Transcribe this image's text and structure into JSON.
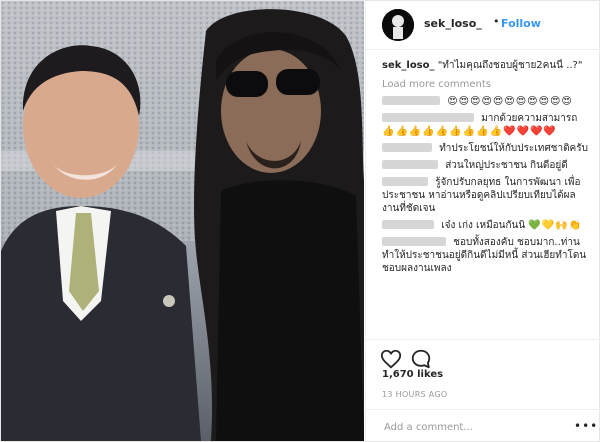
{
  "header": {
    "username": "sek_loso_",
    "separator": "•",
    "follow_label": "Follow"
  },
  "caption": {
    "username": "sek_loso_",
    "text": "\"ทำไมคุณถึงชอบผู้ชาย2คนนี้ ..?\""
  },
  "load_more_label": "Load more comments",
  "comments": [
    {
      "text": "",
      "emoji": "😍😍😍😍😍😍😍😍😍😍😍"
    },
    {
      "text": "มากด้วยความสามารถ",
      "emoji": "👍👍👍👍👍👍👍👍👍❤️❤️❤️❤️"
    },
    {
      "text": "ทำประโยชน์ให้กับประเทศชาติครับ",
      "emoji": ""
    },
    {
      "text": "ส่วนใหญ่ประชาชน กินดีอยู่ดี",
      "emoji": ""
    },
    {
      "text": "รู้จักปรับกลยุทธ ในการพัฒนา เพื่อประชาชน หาอ่านหรือดูคลิปเปรียบเทียบได้ผลงานที่ชัดเจน",
      "emoji": ""
    },
    {
      "text": "เจ๋ง เก่ง เหมือนกันนิ",
      "emoji": "💚💛🙌👏"
    },
    {
      "text": "ชอบทั้งสองคับ ชอบมาก..ท่านทำให้ประชาชนอยู่ดีกินดีไม่มีหนี้ ส่วนเฮียทำโดนชอบผลงานเพลง",
      "emoji": ""
    }
  ],
  "likes": "1,670 likes",
  "timestamp": "13 HOURS AGO",
  "add_comment_placeholder": "Add a comment...",
  "more_options": "•••",
  "colors": {
    "link": "#3897f0",
    "text": "#262626",
    "muted": "#999999",
    "border": "#efefef"
  }
}
